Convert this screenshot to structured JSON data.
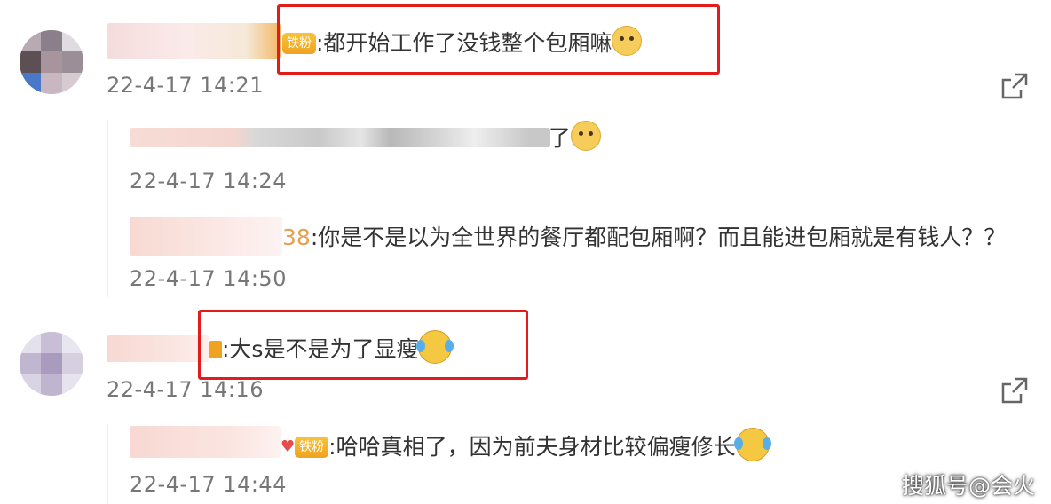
{
  "comments": [
    {
      "text": ":都开始工作了没钱整个包厢嘛",
      "badge": "铁粉",
      "emoji": "doge-emoji",
      "time": "22-4-17 14:21",
      "replies": [
        {
          "text": "了",
          "emoji": "doge-emoji",
          "time": "22-4-17 14:24"
        },
        {
          "prefix": "38",
          "text": ":你是不是以为全世界的餐厅都配包厢啊？而且能进包厢就是有钱人？？",
          "time": "22-4-17 14:50"
        }
      ]
    },
    {
      "text": ":大s是不是为了显瘦",
      "emoji": "laugh-cry-emoji",
      "time": "22-4-17 14:16",
      "replies": [
        {
          "badge": "铁粉",
          "text": ":哈哈真相了，因为前夫身材比较偏瘦修长",
          "emoji": "laugh-cry-emoji",
          "time": "22-4-17 14:44"
        }
      ]
    }
  ],
  "watermark": "搜狐号@会火",
  "colors": {
    "highlight_box": "#e31b1b",
    "badge": "#f0a320",
    "time": "#777777"
  },
  "icons": [
    "share-icon"
  ]
}
